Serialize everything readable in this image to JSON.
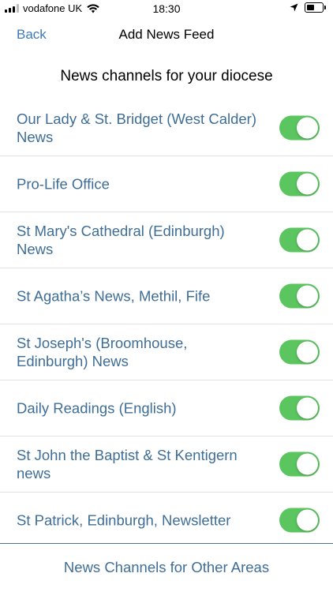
{
  "status_bar": {
    "carrier": "vodafone UK",
    "time": "18:30"
  },
  "nav": {
    "back_label": "Back",
    "title": "Add News Feed"
  },
  "section_header": "News channels for your diocese",
  "channels": [
    {
      "name": "Our Lady & St. Bridget (West Calder) News",
      "enabled": true
    },
    {
      "name": "Pro-Life Office",
      "enabled": true
    },
    {
      "name": "St Mary's Cathedral (Edinburgh) News",
      "enabled": true
    },
    {
      "name": "St Agatha’s News, Methil, Fife",
      "enabled": true
    },
    {
      "name": "St Joseph's (Broomhouse, Edinburgh) News",
      "enabled": true
    },
    {
      "name": "Daily Readings (English)",
      "enabled": true
    },
    {
      "name": "St John the Baptist & St Kentigern news",
      "enabled": true
    },
    {
      "name": "St Patrick, Edinburgh, Newsletter",
      "enabled": true
    }
  ],
  "footer_link": "News Channels for Other Areas",
  "colors": {
    "accent": "#3d7ab8",
    "channel_text": "#3e6e97",
    "toggle_on": "#5bc55f"
  }
}
